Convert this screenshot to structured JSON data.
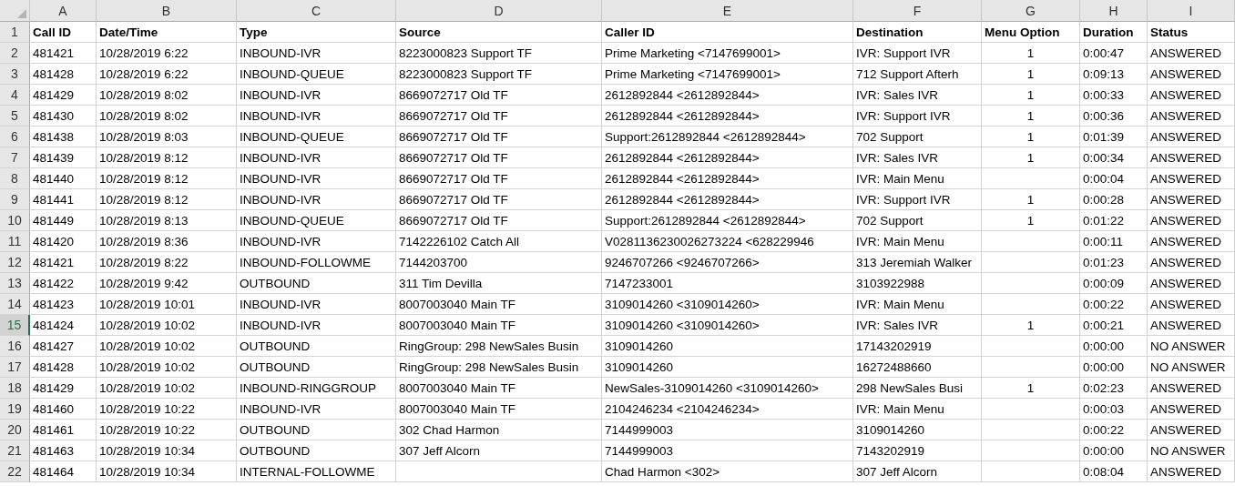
{
  "sheet": {
    "columns": [
      {
        "letter": "A",
        "selected": false
      },
      {
        "letter": "B",
        "selected": false
      },
      {
        "letter": "C",
        "selected": false
      },
      {
        "letter": "D",
        "selected": false
      },
      {
        "letter": "E",
        "selected": false
      },
      {
        "letter": "F",
        "selected": false
      },
      {
        "letter": "G",
        "selected": false
      },
      {
        "letter": "H",
        "selected": false
      },
      {
        "letter": "I",
        "selected": false
      }
    ],
    "rows": [
      {
        "number": "1",
        "selected": false,
        "kind": "header",
        "cells": {
          "A": "Call ID",
          "B": "Date/Time",
          "C": "Type",
          "D": "Source",
          "E": "Caller ID",
          "F": "Destination",
          "G": "Menu Option",
          "H": "Duration",
          "I": "Status"
        }
      },
      {
        "number": "2",
        "selected": false,
        "kind": "data",
        "cells": {
          "A": "481421",
          "B": "10/28/2019 6:22",
          "C": "INBOUND-IVR",
          "D": "8223000823 Support TF",
          "E": "Prime Marketing <7147699001>",
          "F": "IVR: Support IVR",
          "G": "1",
          "H": "0:00:47",
          "I": "ANSWERED"
        }
      },
      {
        "number": "3",
        "selected": false,
        "kind": "data",
        "cells": {
          "A": "481428",
          "B": "10/28/2019 6:22",
          "C": "INBOUND-QUEUE",
          "D": "8223000823 Support TF",
          "E": "Prime Marketing <7147699001>",
          "F": "712 Support Afterh",
          "G": "1",
          "H": "0:09:13",
          "I": "ANSWERED"
        }
      },
      {
        "number": "4",
        "selected": false,
        "kind": "data",
        "cells": {
          "A": "481429",
          "B": "10/28/2019 8:02",
          "C": "INBOUND-IVR",
          "D": "8669072717 Old TF",
          "E": "2612892844 <2612892844>",
          "F": "IVR: Sales IVR",
          "G": "1",
          "H": "0:00:33",
          "I": "ANSWERED"
        }
      },
      {
        "number": "5",
        "selected": false,
        "kind": "data",
        "cells": {
          "A": "481430",
          "B": "10/28/2019 8:02",
          "C": "INBOUND-IVR",
          "D": "8669072717 Old TF",
          "E": "2612892844 <2612892844>",
          "F": "IVR: Support IVR",
          "G": "1",
          "H": "0:00:36",
          "I": "ANSWERED"
        }
      },
      {
        "number": "6",
        "selected": false,
        "kind": "data",
        "cells": {
          "A": "481438",
          "B": "10/28/2019 8:03",
          "C": "INBOUND-QUEUE",
          "D": "8669072717 Old TF",
          "E": "Support:2612892844 <2612892844>",
          "F": "702 Support",
          "G": "1",
          "H": "0:01:39",
          "I": "ANSWERED"
        }
      },
      {
        "number": "7",
        "selected": false,
        "kind": "data",
        "cells": {
          "A": "481439",
          "B": "10/28/2019 8:12",
          "C": "INBOUND-IVR",
          "D": "8669072717 Old TF",
          "E": "2612892844 <2612892844>",
          "F": "IVR: Sales IVR",
          "G": "1",
          "H": "0:00:34",
          "I": "ANSWERED"
        }
      },
      {
        "number": "8",
        "selected": false,
        "kind": "data",
        "cells": {
          "A": "481440",
          "B": "10/28/2019 8:12",
          "C": "INBOUND-IVR",
          "D": "8669072717 Old TF",
          "E": "2612892844 <2612892844>",
          "F": "IVR: Main Menu",
          "H": "0:00:04",
          "I": "ANSWERED"
        }
      },
      {
        "number": "9",
        "selected": false,
        "kind": "data",
        "cells": {
          "A": "481441",
          "B": "10/28/2019 8:12",
          "C": "INBOUND-IVR",
          "D": "8669072717 Old TF",
          "E": "2612892844 <2612892844>",
          "F": "IVR: Support IVR",
          "G": "1",
          "H": "0:00:28",
          "I": "ANSWERED"
        }
      },
      {
        "number": "10",
        "selected": false,
        "kind": "data",
        "cells": {
          "A": "481449",
          "B": "10/28/2019 8:13",
          "C": "INBOUND-QUEUE",
          "D": "8669072717 Old TF",
          "E": "Support:2612892844 <2612892844>",
          "F": "702 Support",
          "G": "1",
          "H": "0:01:22",
          "I": "ANSWERED"
        }
      },
      {
        "number": "11",
        "selected": false,
        "kind": "data",
        "cells": {
          "A": "481420",
          "B": "10/28/2019 8:36",
          "C": "INBOUND-IVR",
          "D": "7142226102 Catch All",
          "E": "V0281136230026273224 <628229946",
          "F": "IVR: Main Menu",
          "H": "0:00:11",
          "I": "ANSWERED"
        }
      },
      {
        "number": "12",
        "selected": false,
        "kind": "data",
        "cells": {
          "A": "481421",
          "B": "10/28/2019 8:22",
          "C": "INBOUND-FOLLOWME",
          "D": "7144203700",
          "E": "9246707266 <9246707266>",
          "F": "313 Jeremiah Walker",
          "H": "0:01:23",
          "I": "ANSWERED"
        }
      },
      {
        "number": "13",
        "selected": false,
        "kind": "data",
        "cells": {
          "A": "481422",
          "B": "10/28/2019 9:42",
          "C": "OUTBOUND",
          "D": "311 Tim Devilla",
          "E": "7147233001",
          "F": "3103922988",
          "H": "0:00:09",
          "I": "ANSWERED"
        }
      },
      {
        "number": "14",
        "selected": false,
        "kind": "data",
        "cells": {
          "A": "481423",
          "B": "10/28/2019 10:01",
          "C": "INBOUND-IVR",
          "D": "8007003040 Main TF",
          "E": "3109014260 <3109014260>",
          "F": "IVR: Main Menu",
          "H": "0:00:22",
          "I": "ANSWERED"
        }
      },
      {
        "number": "15",
        "selected": true,
        "kind": "data",
        "cells": {
          "A": "481424",
          "B": "10/28/2019 10:02",
          "C": "INBOUND-IVR",
          "D": "8007003040 Main TF",
          "E": "3109014260 <3109014260>",
          "F": "IVR: Sales IVR",
          "G": "1",
          "H": "0:00:21",
          "I": "ANSWERED"
        }
      },
      {
        "number": "16",
        "selected": false,
        "kind": "data",
        "cells": {
          "A": "481427",
          "B": "10/28/2019 10:02",
          "C": "OUTBOUND",
          "D": "RingGroup: 298 NewSales Busin",
          "E": "3109014260",
          "F": "17143202919",
          "H": "0:00:00",
          "I": "NO ANSWER"
        }
      },
      {
        "number": "17",
        "selected": false,
        "kind": "data",
        "cells": {
          "A": "481428",
          "B": "10/28/2019 10:02",
          "C": "OUTBOUND",
          "D": "RingGroup: 298 NewSales Busin",
          "E": "3109014260",
          "F": "16272488660",
          "H": "0:00:00",
          "I": "NO ANSWER"
        }
      },
      {
        "number": "18",
        "selected": false,
        "kind": "data",
        "cells": {
          "A": "481429",
          "B": "10/28/2019 10:02",
          "C": "INBOUND-RINGGROUP",
          "D": "8007003040 Main TF",
          "E": "NewSales-3109014260 <3109014260>",
          "F": "298 NewSales Busi",
          "G": "1",
          "H": "0:02:23",
          "I": "ANSWERED"
        }
      },
      {
        "number": "19",
        "selected": false,
        "kind": "data",
        "cells": {
          "A": "481460",
          "B": "10/28/2019 10:22",
          "C": "INBOUND-IVR",
          "D": "8007003040 Main TF",
          "E": "2104246234 <2104246234>",
          "F": "IVR: Main Menu",
          "H": "0:00:03",
          "I": "ANSWERED"
        }
      },
      {
        "number": "20",
        "selected": false,
        "kind": "data",
        "cells": {
          "A": "481461",
          "B": "10/28/2019 10:22",
          "C": "OUTBOUND",
          "D": "302 Chad Harmon",
          "E": "7144999003",
          "F": "3109014260",
          "H": "0:00:22",
          "I": "ANSWERED"
        }
      },
      {
        "number": "21",
        "selected": false,
        "kind": "data",
        "cells": {
          "A": "481463",
          "B": "10/28/2019 10:34",
          "C": "OUTBOUND",
          "D": "307 Jeff Alcorn",
          "E": "7144999003",
          "F": "7143202919",
          "H": "0:00:00",
          "I": "NO ANSWER"
        }
      },
      {
        "number": "22",
        "selected": false,
        "kind": "data",
        "cells": {
          "A": "481464",
          "B": "10/28/2019 10:34",
          "C": "INTERNAL-FOLLOWME",
          "E": "Chad Harmon <302>",
          "F": "307 Jeff Alcorn",
          "H": "0:08:04",
          "I": "ANSWERED"
        }
      }
    ]
  }
}
